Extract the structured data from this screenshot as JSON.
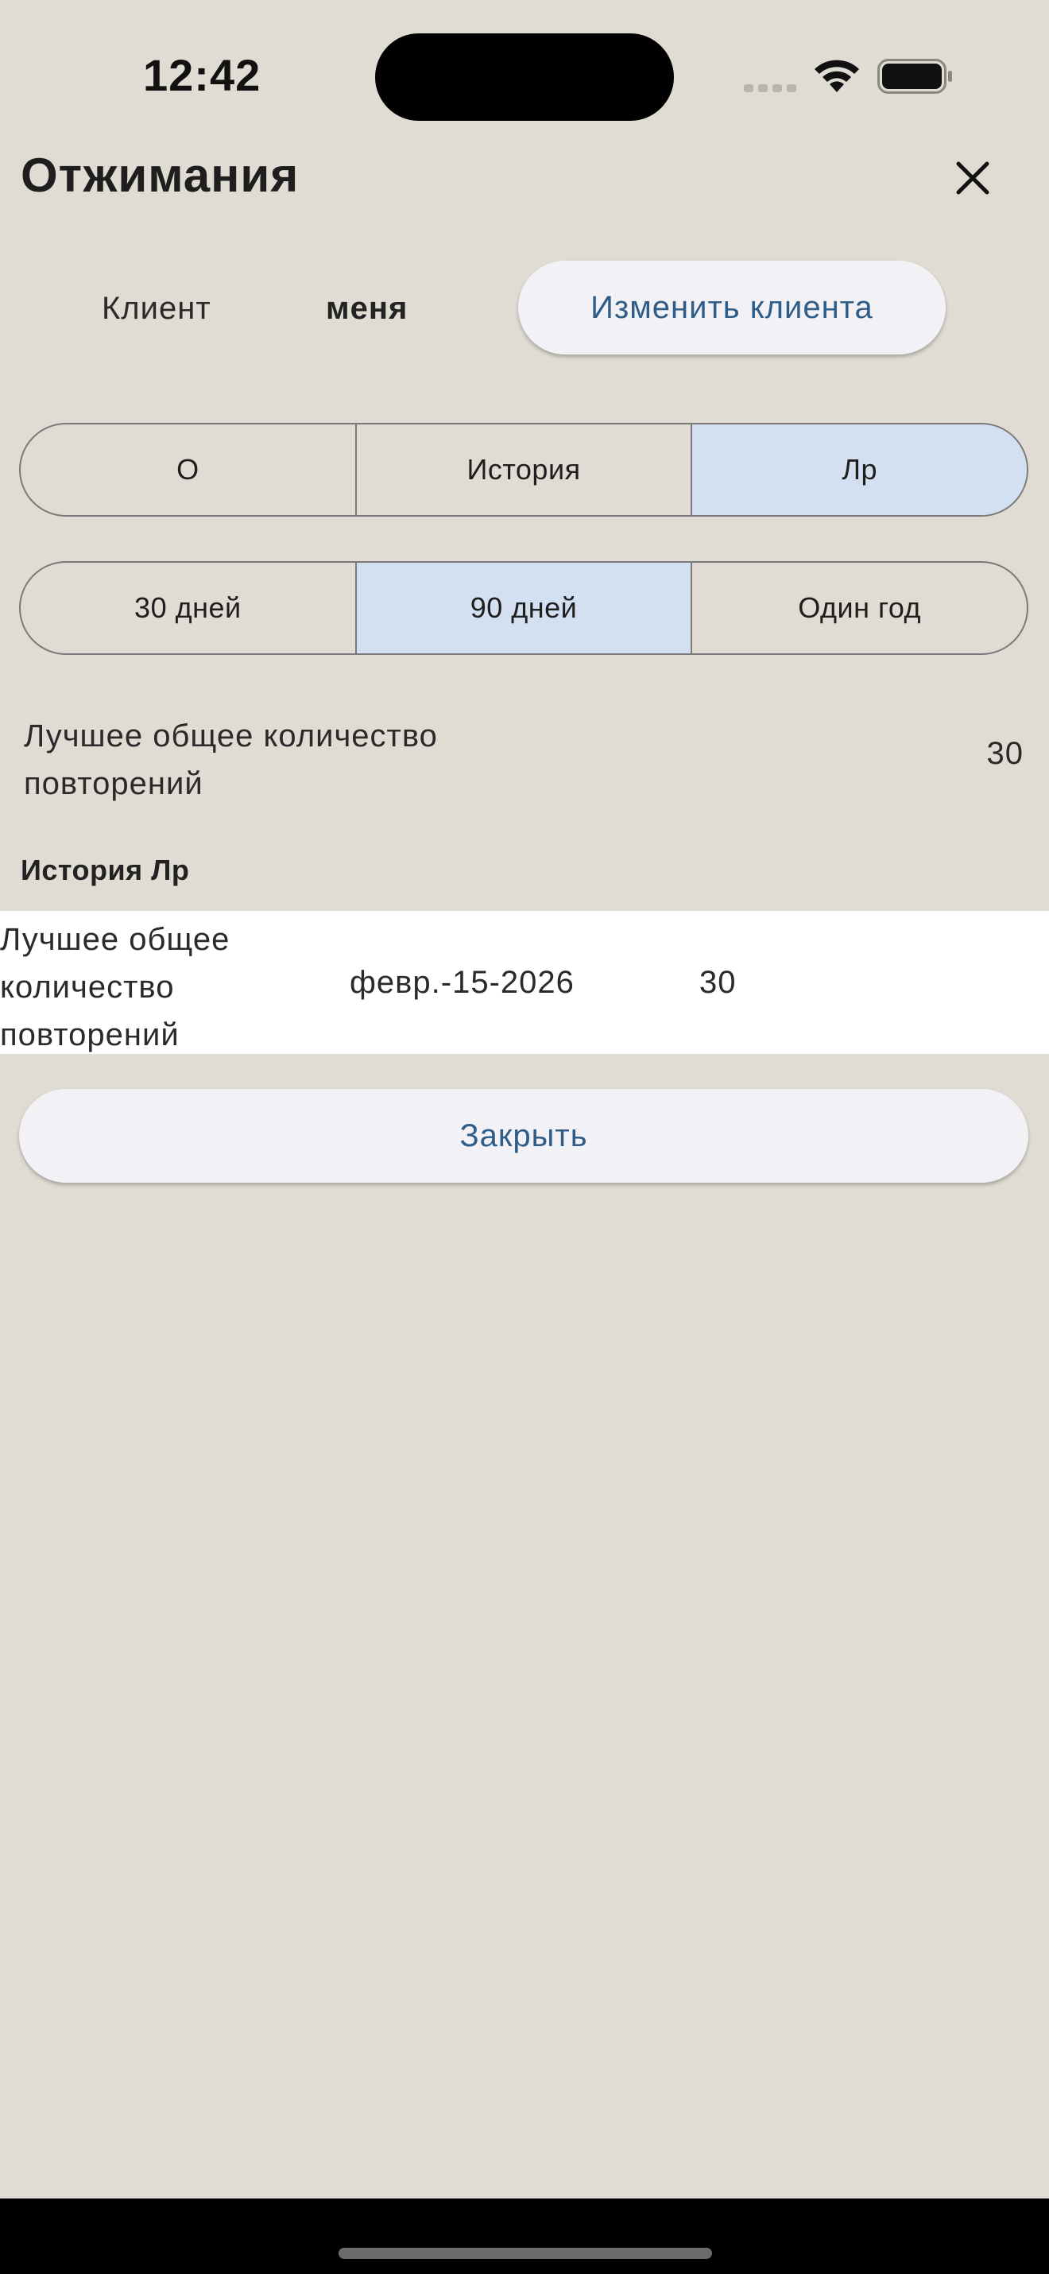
{
  "status_bar": {
    "time": "12:42"
  },
  "header": {
    "title": "Отжимания",
    "close_icon": "close-icon"
  },
  "client": {
    "label": "Клиент",
    "value": "меня",
    "change_button": "Изменить клиента"
  },
  "view_tabs": {
    "items": [
      {
        "label": "О",
        "active": false
      },
      {
        "label": "История",
        "active": false
      },
      {
        "label": "Лр",
        "active": true
      }
    ]
  },
  "period_tabs": {
    "items": [
      {
        "label": "30 дней",
        "active": false
      },
      {
        "label": "90 дней",
        "active": true
      },
      {
        "label": "Один год",
        "active": false
      }
    ]
  },
  "summary": {
    "label": "Лучшее общее количество повторений",
    "value": "30"
  },
  "history": {
    "heading": "История Лр",
    "rows": [
      {
        "metric": "Лучшее общее количество повторений",
        "date": "февр.-15-2026",
        "count": "30"
      }
    ]
  },
  "footer": {
    "close_label": "Закрыть"
  },
  "colors": {
    "background": "#e0dcd3",
    "accent_text": "#2f5d87",
    "active_segment": "#d3e0f2",
    "button_bg": "#f1f1f6"
  }
}
